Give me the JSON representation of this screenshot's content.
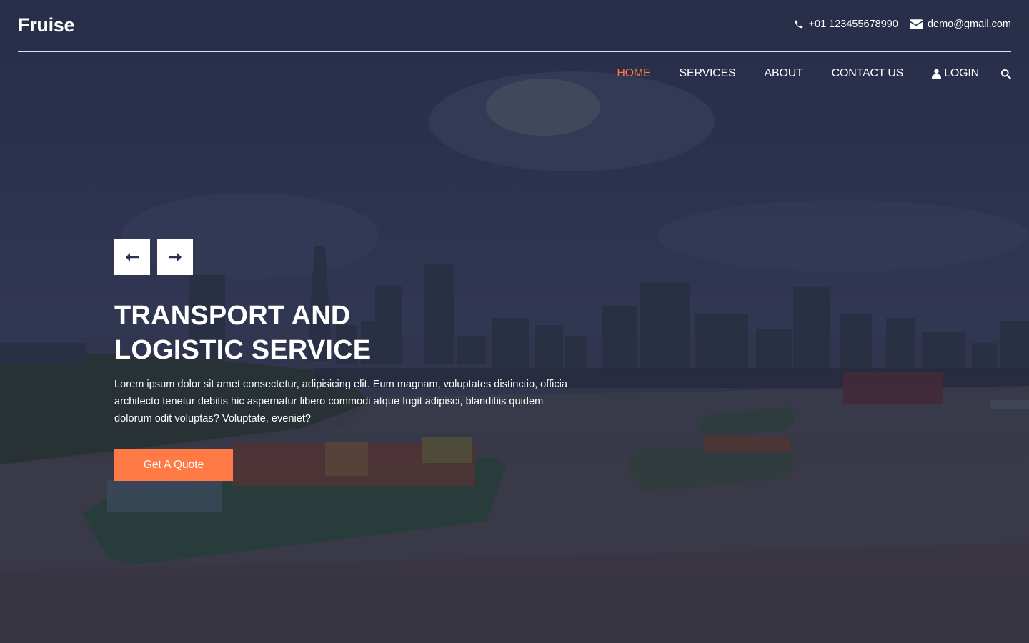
{
  "brand": {
    "name": "Fruise"
  },
  "contact": {
    "phone": "+01 123455678990",
    "email": "demo@gmail.com"
  },
  "nav": {
    "items": [
      {
        "label": "HOME",
        "active": true
      },
      {
        "label": "SERVICES",
        "active": false
      },
      {
        "label": "ABOUT",
        "active": false
      },
      {
        "label": "CONTACT US",
        "active": false
      }
    ],
    "login": "LOGIN"
  },
  "hero": {
    "headline_line1": "TRANSPORT AND",
    "headline_line2": "LOGISTIC SERVICE",
    "description": "Lorem ipsum dolor sit amet consectetur, adipisicing elit. Eum magnam, voluptates distinctio, officia architecto tenetur debitis hic aspernatur libero commodi atque fugit adipisci, blanditiis quidem dolorum odit voluptas? Voluptate, eveniet?",
    "cta": "Get A Quote"
  },
  "icons": {
    "phone": "phone-icon",
    "email": "envelope-icon",
    "user": "user-icon",
    "search": "search-icon",
    "prev": "arrow-left-icon",
    "next": "arrow-right-icon"
  },
  "colors": {
    "accent": "#ff7a45",
    "nav_active": "#ff7a45",
    "text": "#ffffff",
    "arrow_fg": "#2a3350"
  }
}
